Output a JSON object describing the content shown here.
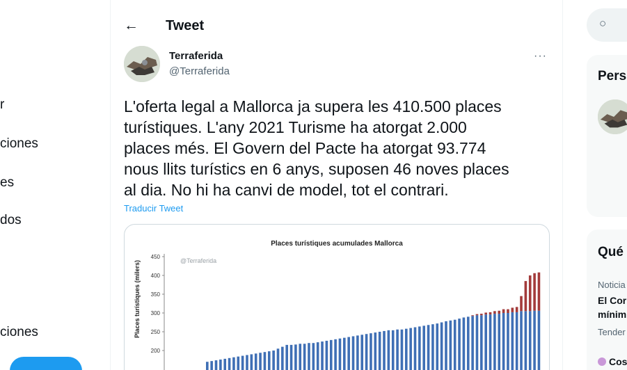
{
  "nav": {
    "items": [
      "r",
      "ciones",
      "es",
      "dos",
      "ciones"
    ]
  },
  "header": {
    "back_icon": "arrow-left-icon",
    "back_glyph": "←",
    "title": "Tweet"
  },
  "author": {
    "name": "Terraferida",
    "handle": "@Terraferida",
    "more_glyph": "···"
  },
  "tweet": {
    "lines": [
      "L'oferta legal a Mallorca ja supera les 410.500 places",
      "turístiques. L'any 2021 Turisme ha atorgat 2.000",
      "places més. El Govern del Pacte ha atorgat 93.774",
      "nous llits turístics en 6 anys, suposen 46 noves places",
      "al dia. No hi ha canvi de model, tot el contrari."
    ],
    "translate": "Traducir Tweet"
  },
  "chart_data": {
    "type": "bar",
    "title": "Places turístiques acumulades Mallorca",
    "watermark": "@Terraferida",
    "ylabel": "Places turístiques (milers)",
    "ylim": [
      0,
      450
    ],
    "yticks": [
      200,
      250,
      300,
      350,
      400,
      450
    ],
    "series": [
      {
        "name": "blue",
        "color": "#3f6fb5",
        "values": [
          170,
          172,
          174,
          176,
          178,
          180,
          182,
          184,
          186,
          188,
          190,
          192,
          194,
          196,
          198,
          200,
          205,
          210,
          215,
          215,
          216,
          218,
          218,
          220,
          220,
          222,
          224,
          226,
          228,
          230,
          232,
          234,
          236,
          238,
          240,
          242,
          244,
          246,
          248,
          250,
          252,
          254,
          254,
          256,
          256,
          258,
          260,
          262,
          264,
          266,
          268,
          270,
          272,
          275,
          278,
          280,
          282,
          285,
          288,
          290,
          292,
          294,
          294,
          296,
          296,
          298,
          298,
          300,
          300,
          302,
          302,
          305,
          305,
          305,
          306,
          306
        ]
      },
      {
        "name": "red",
        "color": "#a33b3b",
        "values": [
          0,
          0,
          0,
          0,
          0,
          0,
          0,
          0,
          0,
          0,
          0,
          0,
          0,
          0,
          0,
          0,
          0,
          0,
          0,
          0,
          0,
          0,
          0,
          0,
          0,
          0,
          0,
          0,
          0,
          0,
          0,
          0,
          0,
          0,
          0,
          0,
          0,
          0,
          0,
          0,
          0,
          0,
          0,
          0,
          0,
          0,
          0,
          0,
          0,
          0,
          0,
          0,
          0,
          0,
          0,
          0,
          0,
          0,
          0,
          0,
          2,
          3,
          4,
          5,
          6,
          7,
          8,
          10,
          10,
          12,
          14,
          40,
          80,
          95,
          100,
          102
        ]
      }
    ]
  },
  "sidebar": {
    "search_icon": "search-icon",
    "search_glyph": "○",
    "card1_title": "Pers",
    "card2_title": "Qué",
    "trend_category": "Noticia",
    "trend_title_1": "El Cor",
    "trend_title_2": "mínim",
    "trend_meta": "Tender",
    "trend2_title": "Cos"
  }
}
